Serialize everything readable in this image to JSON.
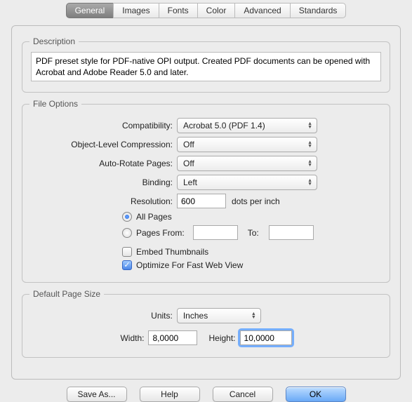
{
  "tabs": {
    "general": "General",
    "images": "Images",
    "fonts": "Fonts",
    "color": "Color",
    "advanced": "Advanced",
    "standards": "Standards"
  },
  "description": {
    "title": "Description",
    "text": "PDF preset style for PDF-native OPI output. Created PDF documents can be opened with Acrobat and Adobe Reader 5.0 and later."
  },
  "fileOptions": {
    "title": "File Options",
    "compatibilityLabel": "Compatibility:",
    "compatibilityValue": "Acrobat 5.0 (PDF 1.4)",
    "objectCompressionLabel": "Object-Level Compression:",
    "objectCompressionValue": "Off",
    "autoRotateLabel": "Auto-Rotate Pages:",
    "autoRotateValue": "Off",
    "bindingLabel": "Binding:",
    "bindingValue": "Left",
    "resolutionLabel": "Resolution:",
    "resolutionValue": "600",
    "resolutionUnit": "dots per inch",
    "allPages": "All Pages",
    "pagesFrom": "Pages From:",
    "pagesFromValue": "",
    "toLabel": "To:",
    "toValue": "",
    "embedThumbnails": "Embed Thumbnails",
    "optimizeFastWeb": "Optimize For Fast Web View"
  },
  "defaultPageSize": {
    "title": "Default Page Size",
    "unitsLabel": "Units:",
    "unitsValue": "Inches",
    "widthLabel": "Width:",
    "widthValue": "8,0000",
    "heightLabel": "Height:",
    "heightValue": "10,0000"
  },
  "buttons": {
    "saveAs": "Save As...",
    "help": "Help",
    "cancel": "Cancel",
    "ok": "OK"
  }
}
